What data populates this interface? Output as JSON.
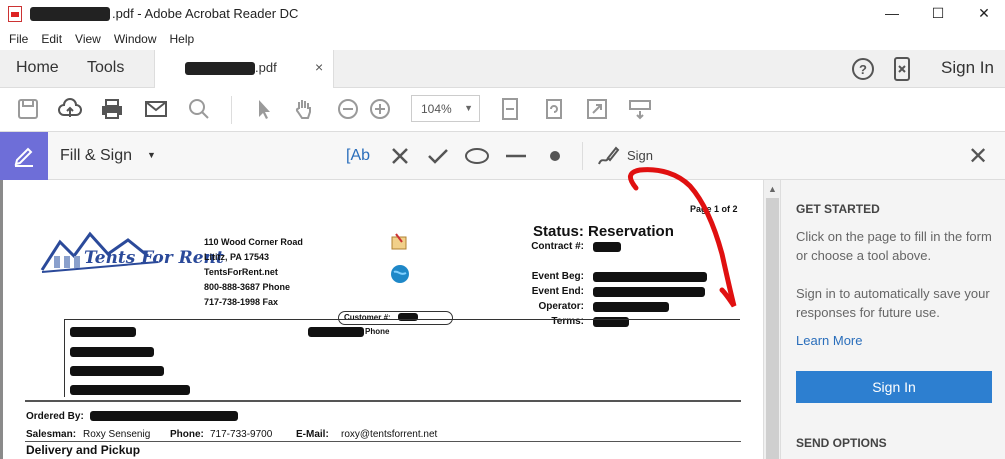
{
  "window": {
    "title_suffix": ".pdf - Adobe Acrobat Reader DC",
    "minimize": "—",
    "maximize": "☐",
    "close": "✕"
  },
  "menu": [
    "File",
    "Edit",
    "View",
    "Window",
    "Help"
  ],
  "tabs": {
    "home": "Home",
    "tools": "Tools",
    "doc_suffix": ".pdf",
    "doc_close": "×",
    "help": "?",
    "sign_in": "Sign In"
  },
  "toolbar": {
    "zoom": "104%"
  },
  "fill_sign": {
    "label": "Fill & Sign",
    "text_tool": "Ab",
    "sign": "Sign"
  },
  "document": {
    "page_label": "Page 1 of 2",
    "company": "Tents For Rent",
    "address": [
      "110 Wood Corner Road",
      "Lititz, PA 17543",
      "TentsForRent.net",
      "800-888-3687 Phone",
      "717-738-1998 Fax"
    ],
    "status": "Status: Reservation",
    "contract_label": "Contract #:",
    "event_beg_label": "Event Beg:",
    "event_end_label": "Event End:",
    "operator_label": "Operator:",
    "terms_label": "Terms:",
    "customer_label": "Customer #:",
    "phone_label": "Phone",
    "ordered_by_label": "Ordered By:",
    "salesman_label": "Salesman:",
    "salesman": "Roxy Sensenig",
    "phone2_label": "Phone:",
    "phone2": "717-733-9700",
    "email_label": "E-Mail:",
    "email": "roxy@tentsforrent.net",
    "section": "Delivery and Pickup"
  },
  "right_panel": {
    "get_started": "GET STARTED",
    "intro": "Click on the page to fill in the form or choose a tool above.",
    "signin_text": "Sign in to automatically save your responses for future use.",
    "learn_more": "Learn More",
    "signin_button": "Sign In",
    "send_options": "SEND OPTIONS"
  }
}
